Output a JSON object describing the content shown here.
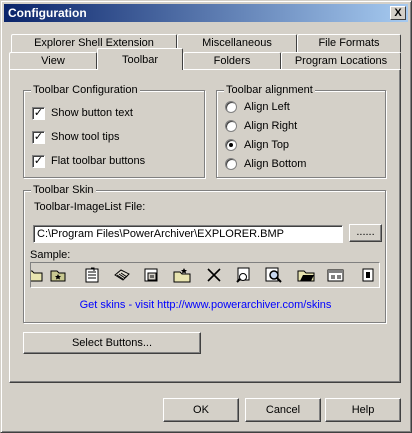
{
  "window": {
    "title": "Configuration",
    "close_label": "X"
  },
  "tabs_back": [
    "Explorer Shell Extension",
    "Miscellaneous",
    "File Formats"
  ],
  "tabs_front": [
    "View",
    "Toolbar",
    "Folders",
    "Program Locations"
  ],
  "active_tab": "Toolbar",
  "toolbar_config": {
    "title": "Toolbar Configuration",
    "options": [
      {
        "label": "Show button text",
        "checked": true
      },
      {
        "label": "Show tool tips",
        "checked": true
      },
      {
        "label": "Flat toolbar buttons",
        "checked": true
      }
    ]
  },
  "toolbar_alignment": {
    "title": "Toolbar alignment",
    "options": [
      {
        "label": "Align Left",
        "selected": false
      },
      {
        "label": "Align Right",
        "selected": false
      },
      {
        "label": "Align Top",
        "selected": true
      },
      {
        "label": "Align Bottom",
        "selected": false
      }
    ]
  },
  "toolbar_skin": {
    "title": "Toolbar Skin",
    "file_label": "Toolbar-ImageList File:",
    "file_value": "C:\\Program Files\\PowerArchiver\\EXPLORER.BMP",
    "browse_label": "......",
    "sample_label": "Sample:",
    "sample_icons": [
      "open-icon",
      "new-archive-icon",
      "add-icon",
      "extract-icon",
      "check-icon",
      "folder-new-icon",
      "delete-icon",
      "find-icon",
      "view-icon",
      "open-folder-icon",
      "properties-icon",
      "exit-icon"
    ],
    "link_text": "Get skins - visit http://www.powerarchiver.com/skins",
    "link_color": "#0000ff"
  },
  "select_buttons_label": "Select Buttons...",
  "buttons": {
    "ok": "OK",
    "cancel": "Cancel",
    "help": "Help"
  }
}
